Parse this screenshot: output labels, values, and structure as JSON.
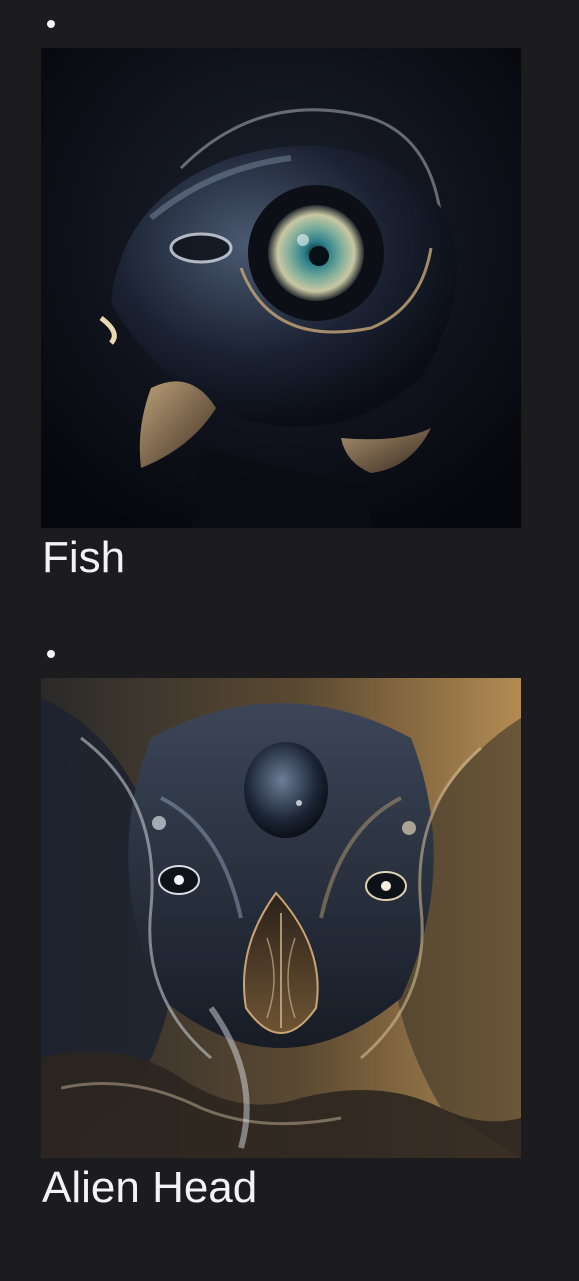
{
  "gallery": {
    "items": [
      {
        "caption": "Fish",
        "image_icon": "fish-artwork"
      },
      {
        "caption": "Alien Head",
        "image_icon": "alien-head-artwork"
      }
    ]
  },
  "colors": {
    "background": "#1c1c1e",
    "text": "#f2f2f7"
  }
}
